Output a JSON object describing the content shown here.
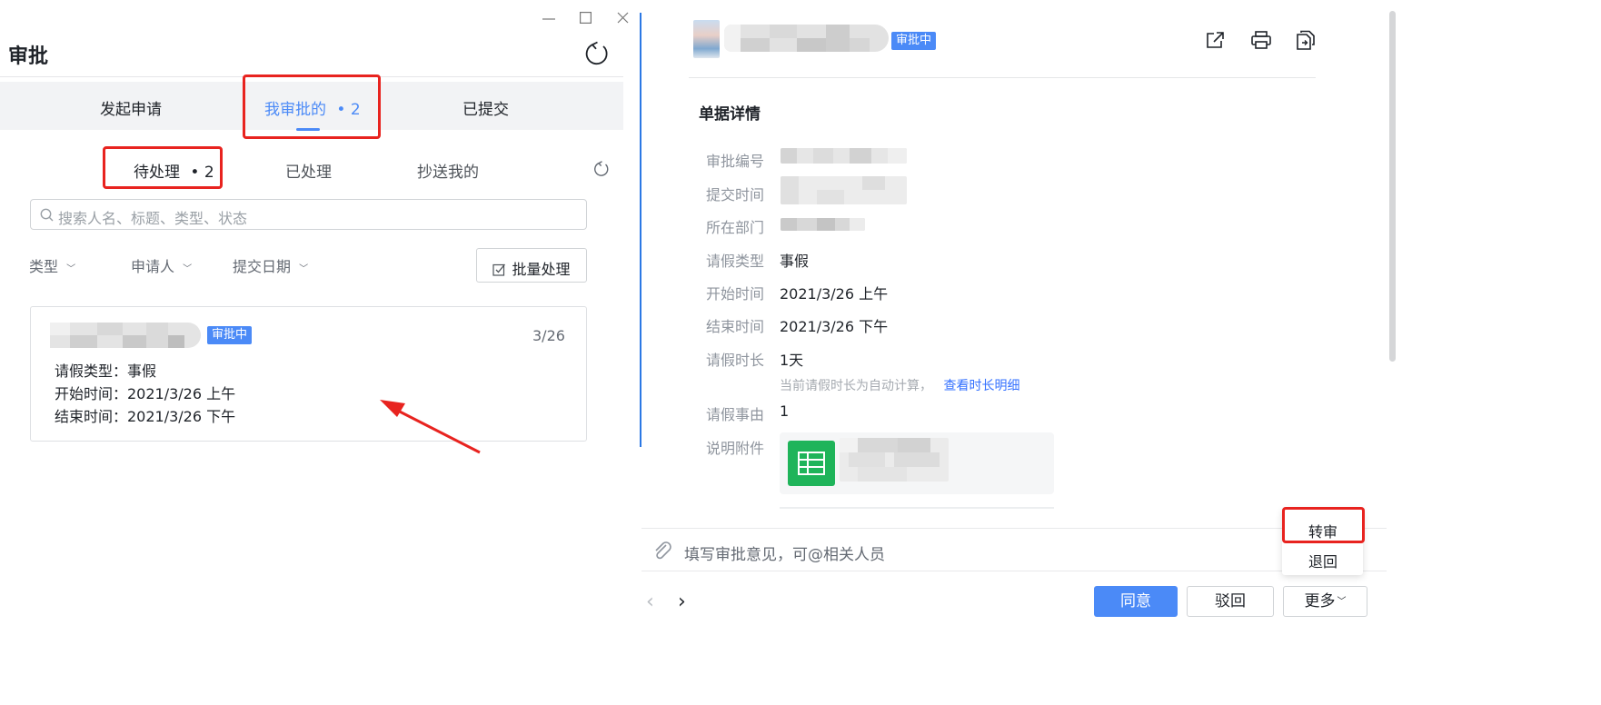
{
  "left": {
    "title": "审批",
    "tabs": [
      {
        "label": "发起申请"
      },
      {
        "label": "我审批的",
        "count": "• 2"
      },
      {
        "label": "已提交"
      }
    ],
    "subtabs": [
      {
        "label": "待处理",
        "count": "• 2"
      },
      {
        "label": "已处理"
      },
      {
        "label": "抄送我的"
      }
    ],
    "search": {
      "placeholder": "搜索人名、标题、类型、状态"
    },
    "filters": [
      {
        "label": "类型"
      },
      {
        "label": "申请人"
      },
      {
        "label": "提交日期"
      }
    ],
    "batch_label": "批量处理",
    "card": {
      "status": "审批中",
      "date": "3/26",
      "lines": [
        "请假类型：事假",
        "开始时间：2021/3/26 上午",
        "结束时间：2021/3/26 下午"
      ]
    }
  },
  "right": {
    "status": "审批中",
    "section_title": "单据详情",
    "fields": [
      {
        "label": "审批编号",
        "value": ""
      },
      {
        "label": "提交时间",
        "value": ""
      },
      {
        "label": "所在部门",
        "value": ""
      },
      {
        "label": "请假类型",
        "value": "事假"
      },
      {
        "label": "开始时间",
        "value": "2021/3/26 上午"
      },
      {
        "label": "结束时间",
        "value": "2021/3/26 下午"
      },
      {
        "label": "请假时长",
        "value": "1天"
      },
      {
        "label": "请假事由",
        "value": "1"
      },
      {
        "label": "说明附件",
        "value": ""
      }
    ],
    "duration_note": "当前请假时长为自动计算，",
    "duration_link": "查看时长明细",
    "comment_placeholder": "填写审批意见，可@相关人员",
    "buttons": {
      "agree": "同意",
      "reject": "驳回",
      "more": "更多"
    },
    "more_menu": [
      "转审",
      "退回"
    ]
  },
  "colors": {
    "accent": "#4b8af7",
    "annotation": "#e8231f",
    "link": "#3370ff",
    "excel_green": "#1fb45a"
  }
}
